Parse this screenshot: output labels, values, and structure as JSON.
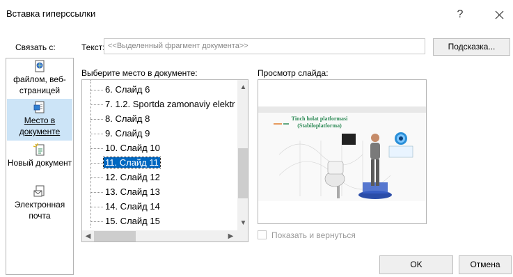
{
  "dialog": {
    "title": "Вставка гиперссылки",
    "help_glyph": "?",
    "close_glyph": "✕"
  },
  "link_to": {
    "label": "Связать с:"
  },
  "text_field": {
    "label": "Текст:",
    "value": "<<Выделенный фрагмент документа>>"
  },
  "hint_button": {
    "label": "Подсказка..."
  },
  "sidebar": {
    "items": [
      {
        "label": "файлом, веб-страницей",
        "icon": "web-page-icon",
        "selected": false
      },
      {
        "label": "Место в документе",
        "icon": "place-in-document-icon",
        "selected": true
      },
      {
        "label": "Новый документ",
        "icon": "new-document-icon",
        "selected": false
      },
      {
        "label": "Электронная почта",
        "icon": "email-icon",
        "selected": false
      }
    ]
  },
  "place": {
    "label": "Выберите место в документе:",
    "items": [
      {
        "label": "6. Слайд 6",
        "selected": false
      },
      {
        "label": "7. 1.2. Sportda zamonaviy elektr",
        "selected": false
      },
      {
        "label": "8. Слайд 8",
        "selected": false
      },
      {
        "label": "9. Слайд 9",
        "selected": false
      },
      {
        "label": "10. Слайд 10",
        "selected": false
      },
      {
        "label": "11. Слайд 11",
        "selected": true
      },
      {
        "label": "12. Слайд 12",
        "selected": false
      },
      {
        "label": "13. Слайд 13",
        "selected": false
      },
      {
        "label": "14. Слайд 14",
        "selected": false
      },
      {
        "label": "15. Слайд 15",
        "selected": false
      }
    ]
  },
  "preview": {
    "label": "Просмотр слайда:",
    "slide_title_line1": "Tinch holat platformasi",
    "slide_title_line2": "(Stabiloplatforma)"
  },
  "show_and_return": {
    "label": "Показать и вернуться",
    "checked": false,
    "enabled": false
  },
  "buttons": {
    "ok": "OK",
    "cancel": "Отмена"
  },
  "colors": {
    "selection": "#0067c0",
    "sidebar_selected": "#cce4f7",
    "slide_title": "#2e8b57",
    "slide_accent": "#e07b2a"
  }
}
